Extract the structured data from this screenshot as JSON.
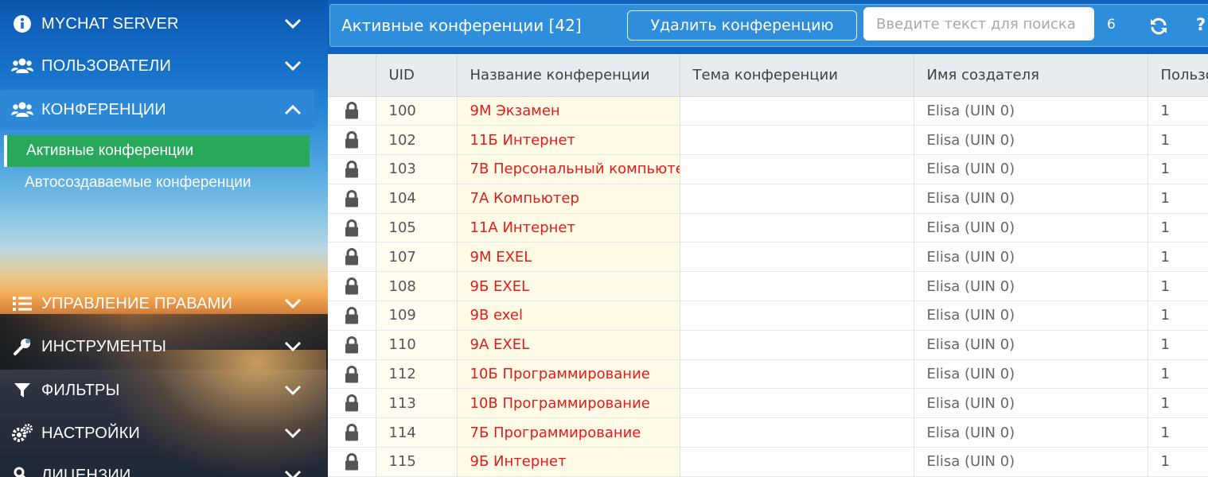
{
  "sidebar": {
    "items": [
      {
        "label": "MYCHAT SERVER",
        "icon": "info-icon",
        "expanded": false
      },
      {
        "label": "ПОЛЬЗОВАТЕЛИ",
        "icon": "users-icon",
        "expanded": false
      },
      {
        "label": "КОНФЕРЕНЦИИ",
        "icon": "users-icon",
        "expanded": true
      },
      {
        "label": "УПРАВЛЕНИЕ ПРАВАМИ",
        "icon": "list-icon",
        "expanded": false
      },
      {
        "label": "ИНСТРУМЕНТЫ",
        "icon": "wrench-icon",
        "expanded": false
      },
      {
        "label": "ФИЛЬТРЫ",
        "icon": "filter-icon",
        "expanded": false
      },
      {
        "label": "НАСТРОЙКИ",
        "icon": "gears-icon",
        "expanded": false
      },
      {
        "label": "ЛИЦЕНЗИИ",
        "icon": "key-icon",
        "expanded": false
      }
    ],
    "subitems": [
      {
        "label": "Активные конференции",
        "active": true
      },
      {
        "label": "Автосоздаваемые конференции",
        "active": false
      }
    ]
  },
  "toolbar": {
    "title": "Активные конференции [42]",
    "delete_label": "Удалить конференцию",
    "search_placeholder": "Введите текст для поиска",
    "count": "6",
    "help": "?"
  },
  "table": {
    "columns": [
      "",
      "UID",
      "Название конференции",
      "Тема конференции",
      "Имя создателя",
      "Пользо"
    ],
    "rows": [
      {
        "uid": "100",
        "name": "9М Экзамен",
        "topic": "",
        "creator": "Elisa (UIN 0)",
        "users": "1"
      },
      {
        "uid": "102",
        "name": "11Б Интернет",
        "topic": "",
        "creator": "Elisa (UIN 0)",
        "users": "1"
      },
      {
        "uid": "103",
        "name": "7В Персональный компьюте",
        "topic": "",
        "creator": "Elisa (UIN 0)",
        "users": "1"
      },
      {
        "uid": "104",
        "name": "7А Компьютер",
        "topic": "",
        "creator": "Elisa (UIN 0)",
        "users": "1"
      },
      {
        "uid": "105",
        "name": "11А Интернет",
        "topic": "",
        "creator": "Elisa (UIN 0)",
        "users": "1"
      },
      {
        "uid": "107",
        "name": "9М EXEL",
        "topic": "",
        "creator": "Elisa (UIN 0)",
        "users": "1"
      },
      {
        "uid": "108",
        "name": "9Б EXEL",
        "topic": "",
        "creator": "Elisa (UIN 0)",
        "users": "1"
      },
      {
        "uid": "109",
        "name": "9В exel",
        "topic": "",
        "creator": "Elisa (UIN 0)",
        "users": "1"
      },
      {
        "uid": "110",
        "name": "9А EXEL",
        "topic": "",
        "creator": "Elisa (UIN 0)",
        "users": "1"
      },
      {
        "uid": "112",
        "name": "10Б Программирование",
        "topic": "",
        "creator": "Elisa (UIN 0)",
        "users": "1"
      },
      {
        "uid": "113",
        "name": "10В Программирование",
        "topic": "",
        "creator": "Elisa (UIN 0)",
        "users": "1"
      },
      {
        "uid": "114",
        "name": "7Б Программирование",
        "topic": "",
        "creator": "Elisa (UIN 0)",
        "users": "1"
      },
      {
        "uid": "115",
        "name": "9Б Интернет",
        "topic": "",
        "creator": "Elisa (UIN 0)",
        "users": "1"
      }
    ]
  },
  "colors": {
    "accent": "#2f8edb",
    "active_subitem": "#27a85a",
    "conference_name": "#e21b1b"
  }
}
